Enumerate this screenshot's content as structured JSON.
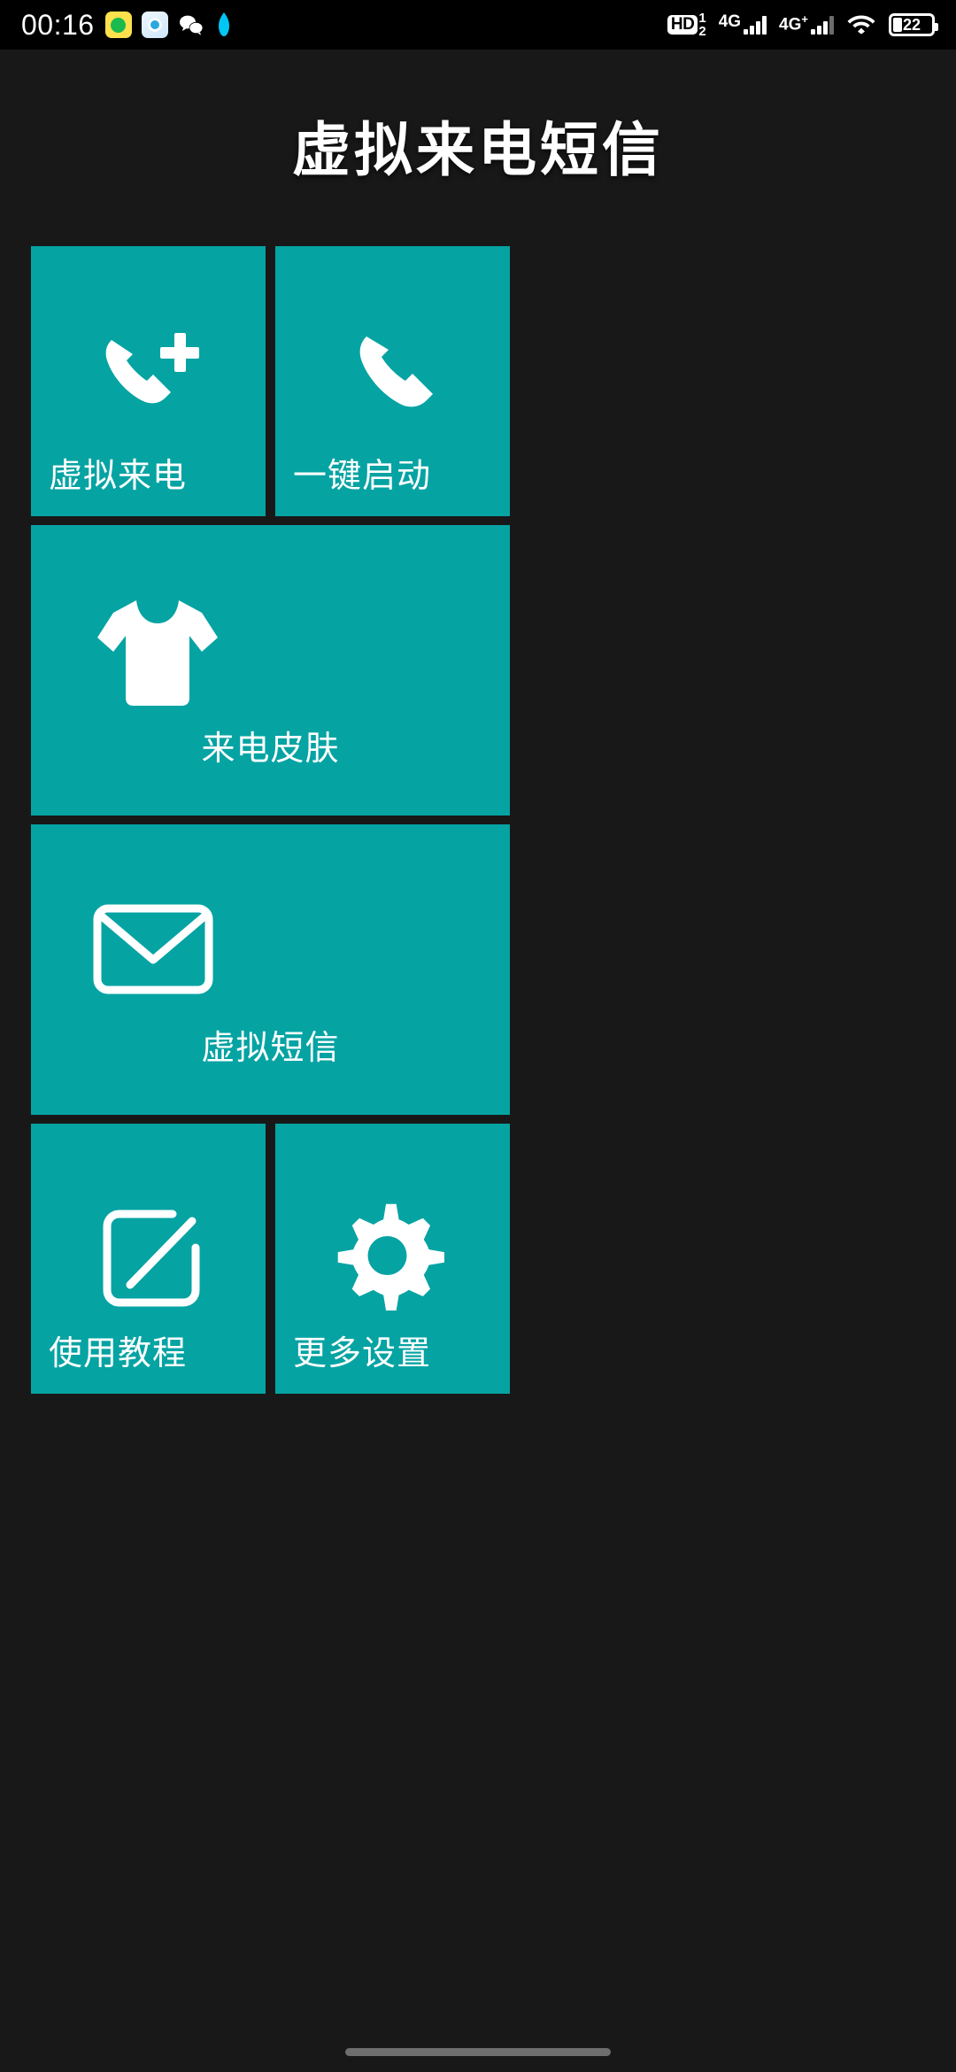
{
  "status_bar": {
    "time": "00:16",
    "app_icons": [
      {
        "name": "qq-music-icon"
      },
      {
        "name": "browser-icon"
      },
      {
        "name": "wechat-icon"
      },
      {
        "name": "qq-icon"
      }
    ],
    "hd_label": "HD",
    "hd_sim1": "1",
    "hd_sim2": "2",
    "signal_1": "4G",
    "signal_2": "4G",
    "signal_2_sup": "+",
    "wifi": "wifi-icon",
    "battery_percent": "22"
  },
  "header": {
    "title": "虚拟来电短信"
  },
  "tiles": [
    {
      "id": "fake-call",
      "label": "虚拟来电",
      "icon": "phone-plus-icon",
      "size": "half"
    },
    {
      "id": "one-key-start",
      "label": "一键启动",
      "icon": "phone-icon",
      "size": "half"
    },
    {
      "id": "call-skin",
      "label": "来电皮肤",
      "icon": "tshirt-icon",
      "size": "full"
    },
    {
      "id": "fake-sms",
      "label": "虚拟短信",
      "icon": "envelope-icon",
      "size": "full"
    },
    {
      "id": "tutorial",
      "label": "使用教程",
      "icon": "edit-square-icon",
      "size": "half"
    },
    {
      "id": "more-settings",
      "label": "更多设置",
      "icon": "gear-icon",
      "size": "half"
    }
  ],
  "theme": {
    "tile_color": "#06A3A3",
    "background": "#181818",
    "text_color": "#FFFFFF"
  },
  "navigation": {
    "gesture_bar": "home-indicator"
  }
}
